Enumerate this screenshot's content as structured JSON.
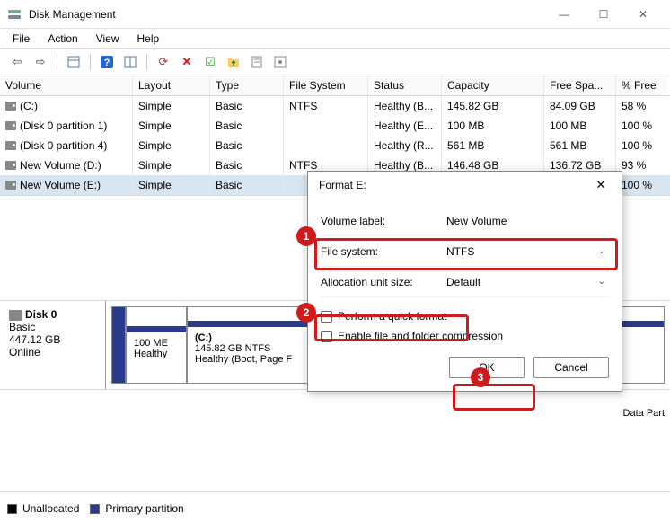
{
  "window": {
    "title": "Disk Management"
  },
  "menus": {
    "file": "File",
    "action": "Action",
    "view": "View",
    "help": "Help"
  },
  "columns": {
    "volume": "Volume",
    "layout": "Layout",
    "type": "Type",
    "fs": "File System",
    "status": "Status",
    "capacity": "Capacity",
    "free": "Free Spa...",
    "pct": "% Free"
  },
  "volumes": [
    {
      "name": "(C:)",
      "layout": "Simple",
      "type": "Basic",
      "fs": "NTFS",
      "status": "Healthy (B...",
      "capacity": "145.82 GB",
      "free": "84.09 GB",
      "pct": "58 %"
    },
    {
      "name": "(Disk 0 partition 1)",
      "layout": "Simple",
      "type": "Basic",
      "fs": "",
      "status": "Healthy (E...",
      "capacity": "100 MB",
      "free": "100 MB",
      "pct": "100 %"
    },
    {
      "name": "(Disk 0 partition 4)",
      "layout": "Simple",
      "type": "Basic",
      "fs": "",
      "status": "Healthy (R...",
      "capacity": "561 MB",
      "free": "561 MB",
      "pct": "100 %"
    },
    {
      "name": "New Volume (D:)",
      "layout": "Simple",
      "type": "Basic",
      "fs": "NTFS",
      "status": "Healthy (B...",
      "capacity": "146.48 GB",
      "free": "136.72 GB",
      "pct": "93 %"
    },
    {
      "name": "New Volume (E:)",
      "layout": "Simple",
      "type": "Basic",
      "fs": "",
      "status": "",
      "capacity": "",
      "free": "",
      "pct": "100 %"
    }
  ],
  "disk": {
    "label": "Disk 0",
    "type": "Basic",
    "size": "447.12 GB",
    "status": "Online",
    "parts": [
      {
        "line1": "100 ME",
        "line2": "Healthy"
      },
      {
        "title": "(C:)",
        "line1": "145.82 GB NTFS",
        "line2": "Healthy (Boot, Page F"
      },
      {
        "title": "",
        "line1": "",
        "line2": "Data Part"
      }
    ]
  },
  "legend": {
    "unalloc": "Unallocated",
    "primary": "Primary partition"
  },
  "dialog": {
    "title": "Format E:",
    "vol_label_lbl": "Volume label:",
    "vol_label_val": "New Volume",
    "fs_lbl": "File system:",
    "fs_val": "NTFS",
    "alloc_lbl": "Allocation unit size:",
    "alloc_val": "Default",
    "chk_quick": "Perform a quick format",
    "chk_compress": "Enable file and folder compression",
    "ok": "OK",
    "cancel": "Cancel"
  },
  "callouts": {
    "n1": "1",
    "n2": "2",
    "n3": "3"
  }
}
